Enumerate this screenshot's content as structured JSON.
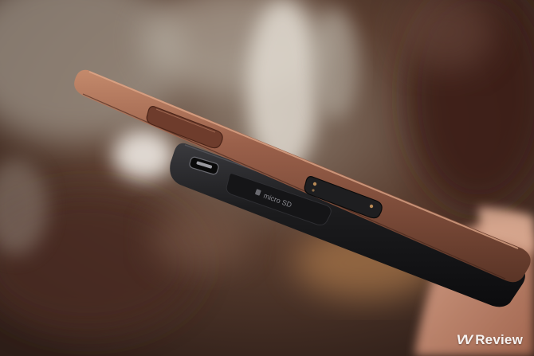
{
  "photo": {
    "subject": "Side profile of two smartphones",
    "upper_device": {
      "finish": "copper",
      "color": "#8a5540"
    },
    "lower_device": {
      "finish": "black",
      "color": "#1c1c1e"
    }
  },
  "slot_label": "micro SD",
  "watermark": {
    "mark": "VV",
    "text": "Review"
  },
  "colors": {
    "background_warm": "#5a3a2a",
    "background_light": "#d8d2c8",
    "copper": "#8a5540",
    "black_phone": "#1c1c1e",
    "skin": "#c8907a"
  }
}
